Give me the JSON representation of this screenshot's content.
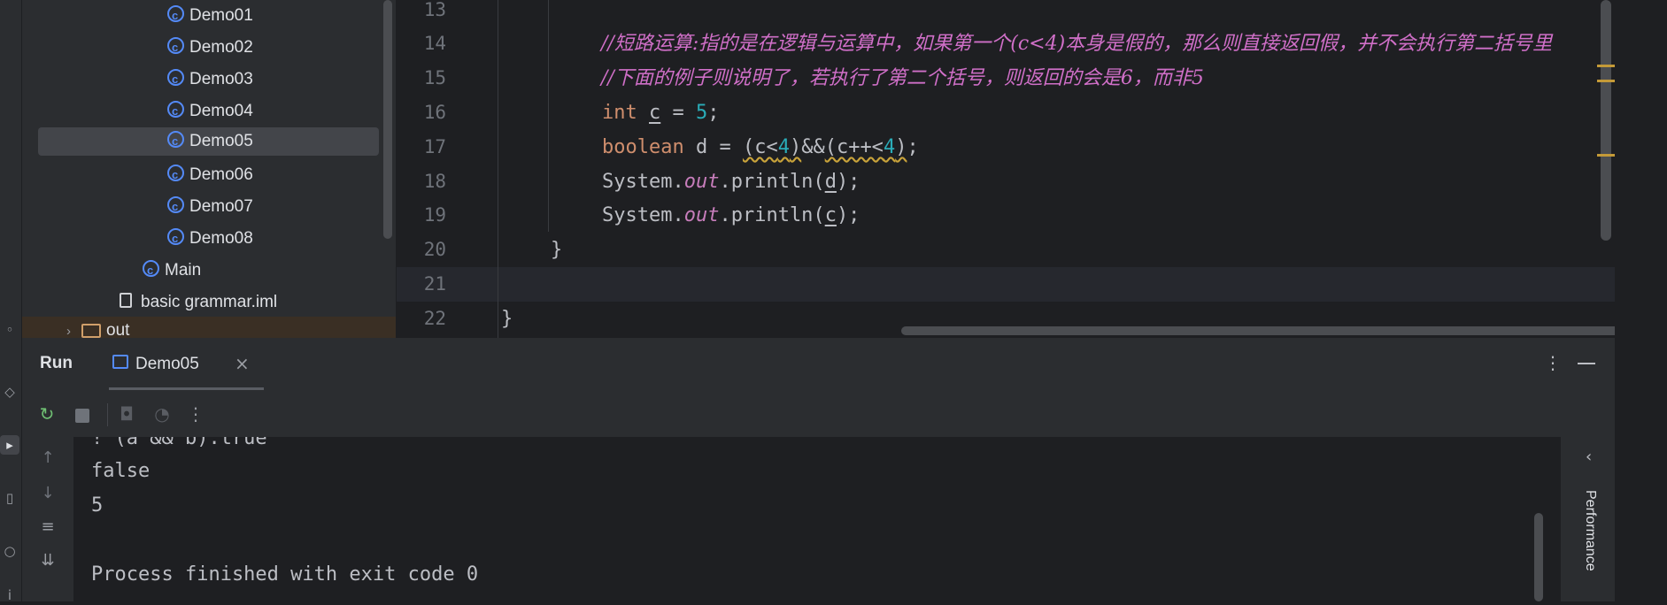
{
  "project_tree": {
    "items": [
      {
        "label": "Demo01",
        "icon": "java-class-icon"
      },
      {
        "label": "Demo02",
        "icon": "java-class-icon"
      },
      {
        "label": "Demo03",
        "icon": "java-class-icon"
      },
      {
        "label": "Demo04",
        "icon": "java-class-icon"
      },
      {
        "label": "Demo05",
        "icon": "java-class-icon",
        "selected": true
      },
      {
        "label": "Demo06",
        "icon": "java-class-icon"
      },
      {
        "label": "Demo07",
        "icon": "java-class-icon"
      },
      {
        "label": "Demo08",
        "icon": "java-class-icon"
      },
      {
        "label": "Main",
        "icon": "java-class-icon"
      },
      {
        "label": "basic grammar.iml",
        "icon": "iml-file-icon"
      },
      {
        "label": "out",
        "icon": "folder-icon"
      }
    ]
  },
  "editor": {
    "line_numbers": [
      "13",
      "14",
      "15",
      "16",
      "17",
      "18",
      "19",
      "20",
      "21",
      "22"
    ],
    "comment1": "//短路运算:指的是在逻辑与运算中，如果第一个(c<4)本身是假的，那么则直接返回假，并不会执行第二括号里",
    "comment2": "//下面的例子则说明了，若执行了第二个括号，则返回的会是6，而非5",
    "line16": {
      "kw": "int",
      "var": "c",
      "eq": " = ",
      "num": "5",
      "end": ";"
    },
    "line17": {
      "kw": "boolean",
      "rest1": " d = ",
      "expr_a": "(c<",
      "num_a": "4",
      "expr_b": ")",
      "op": "&&",
      "expr_c": "(c++<",
      "num_c": "4",
      "expr_d": ")",
      "end": ";"
    },
    "line18": {
      "sys": "System.",
      "out": "out",
      "call": ".println(",
      "arg": "d",
      "end": ");"
    },
    "line19": {
      "sys": "System.",
      "out": "out",
      "call": ".println(",
      "arg": "c",
      "end": ");"
    },
    "line20": "}",
    "line22": "}"
  },
  "run_panel": {
    "title": "Run",
    "tab_label": "Demo05",
    "close_symbol": "×",
    "console_lines": [
      "! (a && b):true",
      "false",
      "5",
      "",
      "Process finished with exit code 0"
    ],
    "side_panel_label": "Performance"
  },
  "colors": {
    "accent": "#548af7",
    "comment": "#d06fc8",
    "keyword": "#cf8e6d",
    "number": "#2aacb8"
  }
}
